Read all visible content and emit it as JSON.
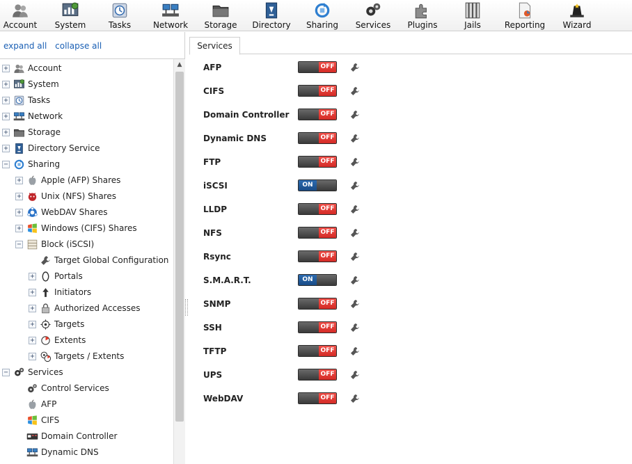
{
  "toolbar": {
    "items": [
      {
        "label": "Account",
        "icon": "account-icon"
      },
      {
        "label": "System",
        "icon": "system-icon"
      },
      {
        "label": "Tasks",
        "icon": "tasks-icon"
      },
      {
        "label": "Network",
        "icon": "network-icon"
      },
      {
        "label": "Storage",
        "icon": "storage-icon"
      },
      {
        "label": "Directory",
        "icon": "directory-icon"
      },
      {
        "label": "Sharing",
        "icon": "sharing-icon"
      },
      {
        "label": "Services",
        "icon": "services-icon"
      },
      {
        "label": "Plugins",
        "icon": "plugins-icon"
      },
      {
        "label": "Jails",
        "icon": "jails-icon"
      },
      {
        "label": "Reporting",
        "icon": "reporting-icon"
      },
      {
        "label": "Wizard",
        "icon": "wizard-icon"
      }
    ]
  },
  "left": {
    "expand_all": "expand all",
    "collapse_all": "collapse all",
    "tree": [
      {
        "label": "Account",
        "icon": "account-icon",
        "expander": "+"
      },
      {
        "label": "System",
        "icon": "system-icon",
        "expander": "+"
      },
      {
        "label": "Tasks",
        "icon": "tasks-icon",
        "expander": "+"
      },
      {
        "label": "Network",
        "icon": "network-icon",
        "expander": "+"
      },
      {
        "label": "Storage",
        "icon": "storage-icon",
        "expander": "+"
      },
      {
        "label": "Directory Service",
        "icon": "directory-icon",
        "expander": "+"
      },
      {
        "label": "Sharing",
        "icon": "sharing-icon",
        "expander": "−"
      },
      {
        "label": "Apple (AFP) Shares",
        "icon": "apple-icon",
        "expander": "+"
      },
      {
        "label": "Unix (NFS) Shares",
        "icon": "unix-icon",
        "expander": "+"
      },
      {
        "label": "WebDAV Shares",
        "icon": "webdav-icon",
        "expander": "+"
      },
      {
        "label": "Windows (CIFS) Shares",
        "icon": "windows-icon",
        "expander": "+"
      },
      {
        "label": "Block (iSCSI)",
        "icon": "block-icon",
        "expander": "−"
      },
      {
        "label": "Target Global Configuration",
        "icon": "wrench-icon",
        "expander": ""
      },
      {
        "label": "Portals",
        "icon": "portal-icon",
        "expander": "+"
      },
      {
        "label": "Initiators",
        "icon": "initiator-icon",
        "expander": "+"
      },
      {
        "label": "Authorized Accesses",
        "icon": "lock-icon",
        "expander": "+"
      },
      {
        "label": "Targets",
        "icon": "target-icon",
        "expander": "+"
      },
      {
        "label": "Extents",
        "icon": "extent-icon",
        "expander": "+"
      },
      {
        "label": "Targets / Extents",
        "icon": "target-extent-icon",
        "expander": "+"
      },
      {
        "label": "Services",
        "icon": "services-icon",
        "expander": "−"
      },
      {
        "label": "Control Services",
        "icon": "gears-icon",
        "expander": ""
      },
      {
        "label": "AFP",
        "icon": "apple-icon",
        "expander": ""
      },
      {
        "label": "CIFS",
        "icon": "windows-icon",
        "expander": ""
      },
      {
        "label": "Domain Controller",
        "icon": "domain-icon",
        "expander": ""
      },
      {
        "label": "Dynamic DNS",
        "icon": "network-icon",
        "expander": ""
      }
    ]
  },
  "main": {
    "tab_label": "Services",
    "services": [
      {
        "name": "AFP",
        "state": "OFF"
      },
      {
        "name": "CIFS",
        "state": "OFF"
      },
      {
        "name": "Domain Controller",
        "state": "OFF"
      },
      {
        "name": "Dynamic DNS",
        "state": "OFF"
      },
      {
        "name": "FTP",
        "state": "OFF"
      },
      {
        "name": "iSCSI",
        "state": "ON"
      },
      {
        "name": "LLDP",
        "state": "OFF"
      },
      {
        "name": "NFS",
        "state": "OFF"
      },
      {
        "name": "Rsync",
        "state": "OFF"
      },
      {
        "name": "S.M.A.R.T.",
        "state": "ON"
      },
      {
        "name": "SNMP",
        "state": "OFF"
      },
      {
        "name": "SSH",
        "state": "OFF"
      },
      {
        "name": "TFTP",
        "state": "OFF"
      },
      {
        "name": "UPS",
        "state": "OFF"
      },
      {
        "name": "WebDAV",
        "state": "OFF"
      }
    ]
  }
}
